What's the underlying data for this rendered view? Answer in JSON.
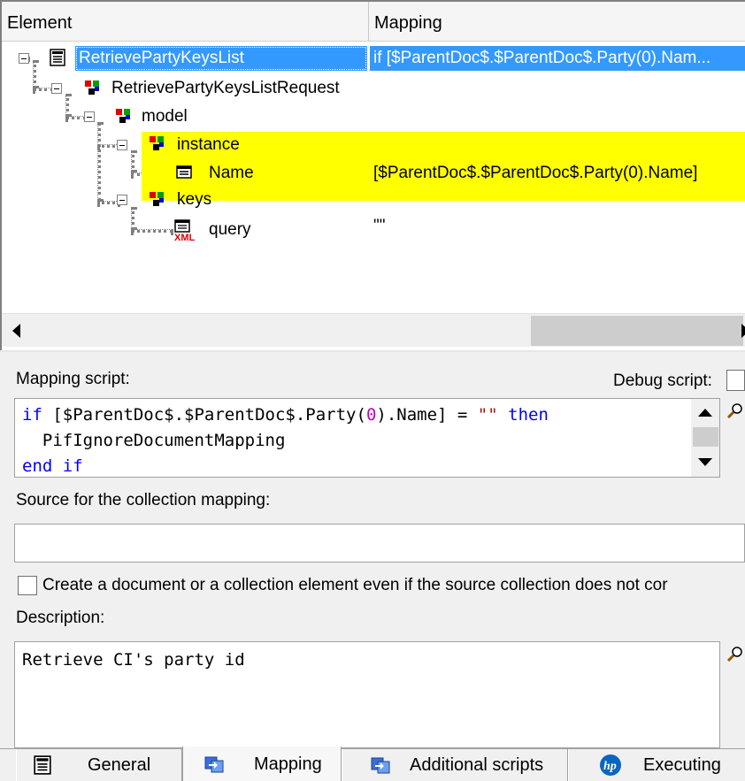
{
  "tree": {
    "columns": {
      "element": "Element",
      "mapping": "Mapping"
    },
    "rows": [
      {
        "label": "RetrievePartyKeysList",
        "mapping": "if [$ParentDoc$.$ParentDoc$.Party(0).Nam...",
        "icon": "document-icon",
        "selected": true
      },
      {
        "label": "RetrievePartyKeysListRequest",
        "mapping": "",
        "icon": "structure-icon"
      },
      {
        "label": "model",
        "mapping": "",
        "icon": "structure-icon"
      },
      {
        "label": "instance",
        "mapping": "",
        "icon": "structure-icon",
        "highlighted": true
      },
      {
        "label": "Name",
        "mapping": "[$ParentDoc$.$ParentDoc$.Party(0).Name]",
        "icon": "field-icon",
        "highlighted": true
      },
      {
        "label": "keys",
        "mapping": "",
        "icon": "structure-icon",
        "highlighted": true
      },
      {
        "label": "query",
        "mapping": "\"\"",
        "icon": "xml-field-icon"
      }
    ],
    "highlight_color": "#ffff00",
    "selection_color": "#3399ff"
  },
  "mapping_script": {
    "label": "Mapping script:",
    "debug_label": "Debug script:",
    "lines": {
      "l1_kw_if": "if",
      "l1_a": " [$ParentDoc$.$ParentDoc$.Party(",
      "l1_num": "0",
      "l1_b": ").Name] = ",
      "l1_str": "\"\"",
      "l1_sp": " ",
      "l1_kw_then": "then",
      "l2": "  PifIgnoreDocumentMapping",
      "l3_kw": "end if"
    }
  },
  "collection": {
    "label": "Source for the collection mapping:",
    "value": ""
  },
  "create_option": {
    "label": "Create a document or a collection element even if the source collection does not cor",
    "checked": false
  },
  "description": {
    "label": "Description:",
    "value": "Retrieve CI's party id"
  },
  "tabs": [
    {
      "label": "General",
      "icon": "document-icon"
    },
    {
      "label": "Mapping",
      "icon": "mapping-icon",
      "active": true
    },
    {
      "label": "Additional scripts",
      "icon": "scripts-icon"
    },
    {
      "label": "Executing",
      "icon": "hp-logo-icon"
    }
  ]
}
